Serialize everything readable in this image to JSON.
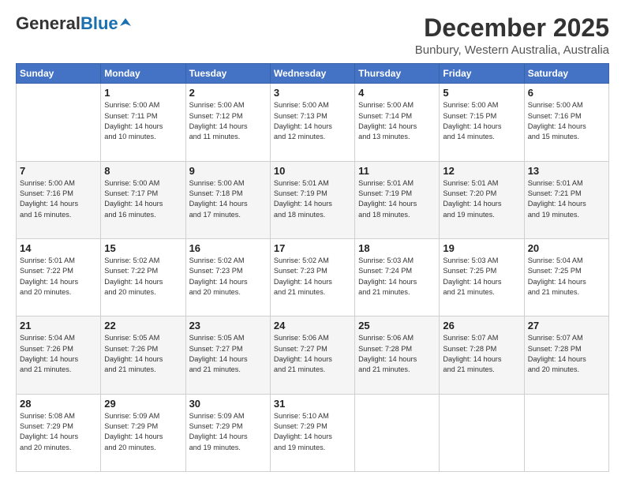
{
  "header": {
    "logo_general": "General",
    "logo_blue": "Blue",
    "month_title": "December 2025",
    "location": "Bunbury, Western Australia, Australia"
  },
  "columns": [
    "Sunday",
    "Monday",
    "Tuesday",
    "Wednesday",
    "Thursday",
    "Friday",
    "Saturday"
  ],
  "weeks": [
    [
      {
        "day": "",
        "info": ""
      },
      {
        "day": "1",
        "info": "Sunrise: 5:00 AM\nSunset: 7:11 PM\nDaylight: 14 hours\nand 10 minutes."
      },
      {
        "day": "2",
        "info": "Sunrise: 5:00 AM\nSunset: 7:12 PM\nDaylight: 14 hours\nand 11 minutes."
      },
      {
        "day": "3",
        "info": "Sunrise: 5:00 AM\nSunset: 7:13 PM\nDaylight: 14 hours\nand 12 minutes."
      },
      {
        "day": "4",
        "info": "Sunrise: 5:00 AM\nSunset: 7:14 PM\nDaylight: 14 hours\nand 13 minutes."
      },
      {
        "day": "5",
        "info": "Sunrise: 5:00 AM\nSunset: 7:15 PM\nDaylight: 14 hours\nand 14 minutes."
      },
      {
        "day": "6",
        "info": "Sunrise: 5:00 AM\nSunset: 7:16 PM\nDaylight: 14 hours\nand 15 minutes."
      }
    ],
    [
      {
        "day": "7",
        "info": "Sunrise: 5:00 AM\nSunset: 7:16 PM\nDaylight: 14 hours\nand 16 minutes."
      },
      {
        "day": "8",
        "info": "Sunrise: 5:00 AM\nSunset: 7:17 PM\nDaylight: 14 hours\nand 16 minutes."
      },
      {
        "day": "9",
        "info": "Sunrise: 5:00 AM\nSunset: 7:18 PM\nDaylight: 14 hours\nand 17 minutes."
      },
      {
        "day": "10",
        "info": "Sunrise: 5:01 AM\nSunset: 7:19 PM\nDaylight: 14 hours\nand 18 minutes."
      },
      {
        "day": "11",
        "info": "Sunrise: 5:01 AM\nSunset: 7:19 PM\nDaylight: 14 hours\nand 18 minutes."
      },
      {
        "day": "12",
        "info": "Sunrise: 5:01 AM\nSunset: 7:20 PM\nDaylight: 14 hours\nand 19 minutes."
      },
      {
        "day": "13",
        "info": "Sunrise: 5:01 AM\nSunset: 7:21 PM\nDaylight: 14 hours\nand 19 minutes."
      }
    ],
    [
      {
        "day": "14",
        "info": "Sunrise: 5:01 AM\nSunset: 7:22 PM\nDaylight: 14 hours\nand 20 minutes."
      },
      {
        "day": "15",
        "info": "Sunrise: 5:02 AM\nSunset: 7:22 PM\nDaylight: 14 hours\nand 20 minutes."
      },
      {
        "day": "16",
        "info": "Sunrise: 5:02 AM\nSunset: 7:23 PM\nDaylight: 14 hours\nand 20 minutes."
      },
      {
        "day": "17",
        "info": "Sunrise: 5:02 AM\nSunset: 7:23 PM\nDaylight: 14 hours\nand 21 minutes."
      },
      {
        "day": "18",
        "info": "Sunrise: 5:03 AM\nSunset: 7:24 PM\nDaylight: 14 hours\nand 21 minutes."
      },
      {
        "day": "19",
        "info": "Sunrise: 5:03 AM\nSunset: 7:25 PM\nDaylight: 14 hours\nand 21 minutes."
      },
      {
        "day": "20",
        "info": "Sunrise: 5:04 AM\nSunset: 7:25 PM\nDaylight: 14 hours\nand 21 minutes."
      }
    ],
    [
      {
        "day": "21",
        "info": "Sunrise: 5:04 AM\nSunset: 7:26 PM\nDaylight: 14 hours\nand 21 minutes."
      },
      {
        "day": "22",
        "info": "Sunrise: 5:05 AM\nSunset: 7:26 PM\nDaylight: 14 hours\nand 21 minutes."
      },
      {
        "day": "23",
        "info": "Sunrise: 5:05 AM\nSunset: 7:27 PM\nDaylight: 14 hours\nand 21 minutes."
      },
      {
        "day": "24",
        "info": "Sunrise: 5:06 AM\nSunset: 7:27 PM\nDaylight: 14 hours\nand 21 minutes."
      },
      {
        "day": "25",
        "info": "Sunrise: 5:06 AM\nSunset: 7:28 PM\nDaylight: 14 hours\nand 21 minutes."
      },
      {
        "day": "26",
        "info": "Sunrise: 5:07 AM\nSunset: 7:28 PM\nDaylight: 14 hours\nand 21 minutes."
      },
      {
        "day": "27",
        "info": "Sunrise: 5:07 AM\nSunset: 7:28 PM\nDaylight: 14 hours\nand 20 minutes."
      }
    ],
    [
      {
        "day": "28",
        "info": "Sunrise: 5:08 AM\nSunset: 7:29 PM\nDaylight: 14 hours\nand 20 minutes."
      },
      {
        "day": "29",
        "info": "Sunrise: 5:09 AM\nSunset: 7:29 PM\nDaylight: 14 hours\nand 20 minutes."
      },
      {
        "day": "30",
        "info": "Sunrise: 5:09 AM\nSunset: 7:29 PM\nDaylight: 14 hours\nand 19 minutes."
      },
      {
        "day": "31",
        "info": "Sunrise: 5:10 AM\nSunset: 7:29 PM\nDaylight: 14 hours\nand 19 minutes."
      },
      {
        "day": "",
        "info": ""
      },
      {
        "day": "",
        "info": ""
      },
      {
        "day": "",
        "info": ""
      }
    ]
  ]
}
